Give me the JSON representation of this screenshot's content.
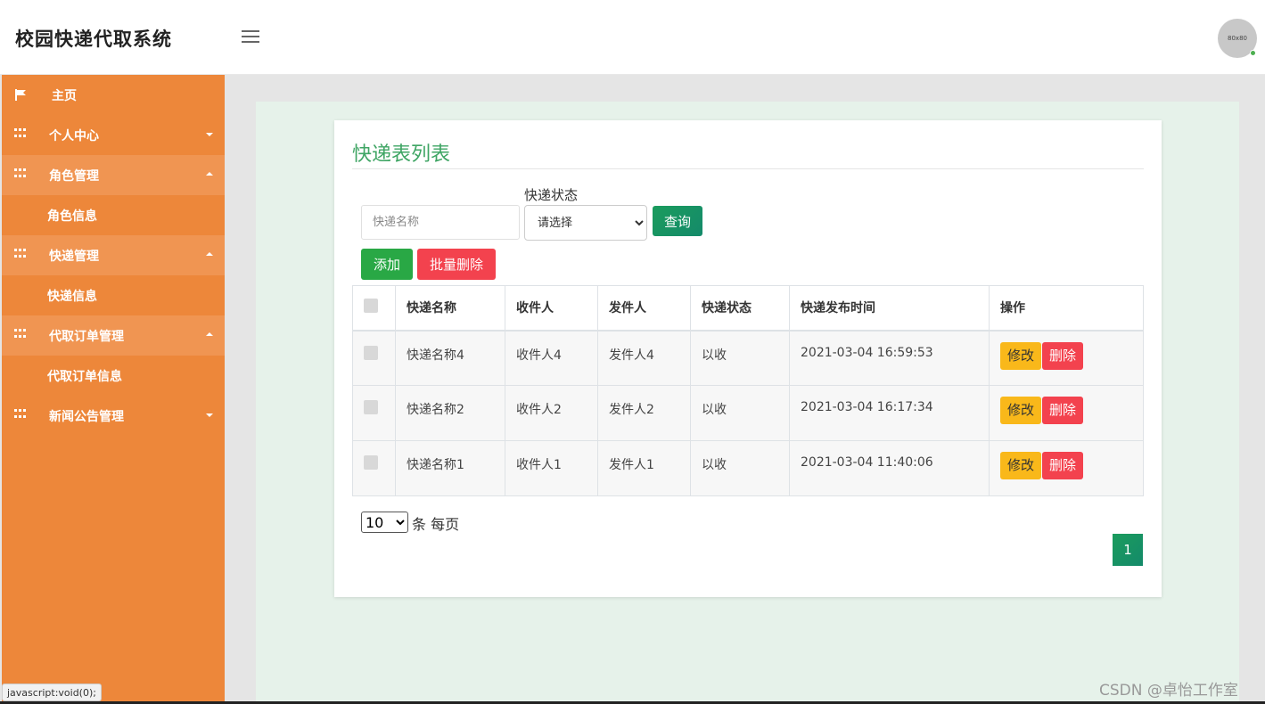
{
  "header": {
    "title": "校园快递代取系统",
    "avatar_text": "80x80"
  },
  "sidebar": {
    "items": [
      {
        "label": "主页"
      },
      {
        "label": "个人中心"
      },
      {
        "label": "角色管理",
        "sub": "角色信息"
      },
      {
        "label": "快递管理",
        "sub": "快递信息"
      },
      {
        "label": "代取订单管理",
        "sub": "代取订单信息"
      },
      {
        "label": "新闻公告管理"
      }
    ]
  },
  "main": {
    "title": "快递表列表",
    "search": {
      "name_placeholder": "快递名称",
      "status_label": "快递状态",
      "status_value": "请选择",
      "query_label": "查询"
    },
    "actions": {
      "add_label": "添加",
      "batch_delete_label": "批量删除"
    },
    "table": {
      "headers": [
        "快递名称",
        "收件人",
        "发件人",
        "快递状态",
        "快递发布时间",
        "操作"
      ],
      "rows": [
        {
          "name": "快递名称4",
          "receiver": "收件人4",
          "sender": "发件人4",
          "status": "以收",
          "time": "2021-03-04 16:59:53"
        },
        {
          "name": "快递名称2",
          "receiver": "收件人2",
          "sender": "发件人2",
          "status": "以收",
          "time": "2021-03-04 16:17:34"
        },
        {
          "name": "快递名称1",
          "receiver": "收件人1",
          "sender": "发件人1",
          "status": "以收",
          "time": "2021-03-04 11:40:06"
        }
      ],
      "edit_label": "修改",
      "delete_label": "删除"
    },
    "pagination": {
      "page_size": "10",
      "page_size_suffix": "条 每页",
      "current_page": "1"
    }
  },
  "status_bar": {
    "text": "javascript:void(0);"
  },
  "watermark": "CSDN @卓怡工作室"
}
